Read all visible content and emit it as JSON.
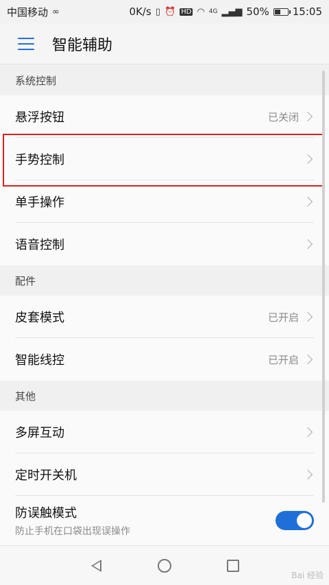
{
  "status_bar": {
    "carrier": "中国移动",
    "speed": "0K/s",
    "hd": "HD",
    "network": "4G",
    "battery_text": "50%",
    "battery_level": 0.5,
    "time": "15:05"
  },
  "app_bar": {
    "title": "智能辅助"
  },
  "sections": {
    "system": {
      "header": "系统控制",
      "items": [
        {
          "label": "悬浮按钮",
          "status": "已关闭"
        },
        {
          "label": "手势控制",
          "status": ""
        },
        {
          "label": "单手操作",
          "status": ""
        },
        {
          "label": "语音控制",
          "status": ""
        }
      ]
    },
    "accessories": {
      "header": "配件",
      "items": [
        {
          "label": "皮套模式",
          "status": "已开启"
        },
        {
          "label": "智能线控",
          "status": "已开启"
        }
      ]
    },
    "other": {
      "header": "其他",
      "items": [
        {
          "label": "多屏互动",
          "status": ""
        },
        {
          "label": "定时开关机",
          "status": ""
        }
      ],
      "toggle_item": {
        "label": "防误触模式",
        "sub": "防止手机在口袋出现误操作",
        "on": true
      }
    }
  },
  "watermark": "Bai 经验",
  "colors": {
    "accent": "#1f6fd8",
    "highlight": "#d9201f"
  }
}
